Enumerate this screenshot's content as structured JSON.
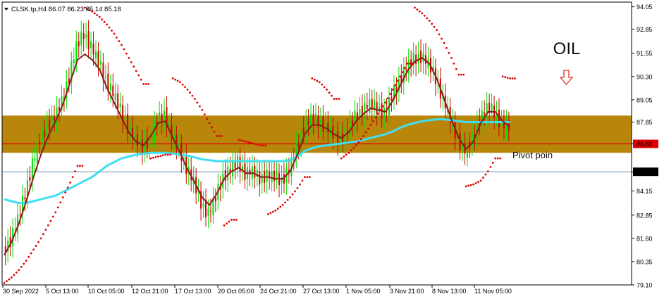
{
  "header": {
    "dropdown_icon": "triangle-down-icon",
    "symbol_info": "CLSK.tp,H4  86.07 86.23 85.14 85.18"
  },
  "annotations": {
    "instrument_label": "OIL",
    "arrow_icon": "hollow-down-arrow-icon",
    "pivot_label": "Pivot poin"
  },
  "colors": {
    "zone": "#b8860b",
    "pivot_line": "#e00000",
    "bull_candle": "#00e000",
    "bear_candle": "#d00000",
    "sar_dots": "#e00000",
    "fast_ma": "#8b1a1a",
    "slow_ma": "#40e0f0",
    "current_price_line": "#5a7ea8",
    "arrow": "#e03020"
  },
  "chart_data": {
    "type": "candlestick",
    "symbol": "CLSK.tp",
    "timeframe": "H4",
    "ohlc_last": {
      "open": 86.07,
      "high": 86.23,
      "low": 85.14,
      "close": 85.18
    },
    "ylim": [
      79.1,
      94.3
    ],
    "y_ticks": [
      "94.05",
      "92.85",
      "91.55",
      "90.30",
      "89.05",
      "87.85",
      "86.68",
      "85.18",
      "84.15",
      "82.85",
      "81.60",
      "80.35",
      "79.10"
    ],
    "x_ticks": [
      "30 Sep 2022",
      "5 Oct 13:00",
      "10 Oct 05:00",
      "12 Oct 21:00",
      "17 Oct 13:00",
      "20 Oct 05:00",
      "24 Oct 21:00",
      "27 Oct 13:00",
      "1 Nov 05:00",
      "3 Nov 21:00",
      "8 Nov 13:00",
      "11 Nov 05:00"
    ],
    "resistance_zone": {
      "low": 86.2,
      "high": 88.2
    },
    "pivot_level": 86.68,
    "current_price": 85.18,
    "close_path": [
      80.9,
      81.5,
      82.6,
      84.0,
      85.6,
      86.9,
      87.6,
      88.1,
      88.9,
      90.3,
      91.9,
      92.6,
      91.9,
      91.1,
      90.1,
      89.4,
      88.5,
      87.6,
      86.9,
      86.5,
      86.9,
      87.9,
      88.3,
      87.1,
      86.4,
      85.4,
      84.6,
      83.5,
      82.9,
      83.8,
      84.9,
      85.3,
      85.7,
      85.1,
      85.2,
      84.8,
      85.0,
      84.9,
      84.7,
      85.3,
      86.4,
      87.6,
      88.0,
      87.9,
      87.6,
      87.2,
      86.9,
      87.4,
      88.1,
      88.5,
      88.8,
      88.6,
      88.3,
      89.2,
      90.0,
      90.8,
      91.2,
      91.4,
      91.0,
      90.2,
      89.1,
      88.0,
      86.9,
      86.3,
      86.9,
      88.0,
      88.6,
      88.4,
      87.7,
      87.6
    ],
    "fast_ma": [
      80.7,
      81.4,
      82.4,
      83.6,
      84.9,
      86.1,
      87.1,
      87.9,
      88.8,
      90.0,
      91.2,
      91.5,
      91.2,
      90.7,
      89.7,
      88.9,
      88.1,
      87.3,
      86.8,
      86.6,
      87.1,
      87.8,
      87.9,
      87.0,
      86.2,
      85.3,
      84.6,
      83.8,
      83.4,
      84.0,
      84.8,
      85.2,
      85.4,
      85.1,
      85.1,
      84.9,
      84.9,
      84.8,
      84.8,
      85.2,
      86.1,
      87.2,
      87.7,
      87.7,
      87.5,
      87.2,
      87.0,
      87.3,
      87.9,
      88.3,
      88.6,
      88.5,
      88.4,
      89.0,
      89.8,
      90.6,
      91.1,
      91.3,
      91.0,
      90.2,
      89.1,
      88.0,
      87.0,
      86.4,
      86.8,
      87.8,
      88.4,
      88.4,
      87.9,
      87.6
    ],
    "slow_ma": [
      83.7,
      83.6,
      83.5,
      83.5,
      83.6,
      83.7,
      83.8,
      83.9,
      84.1,
      84.3,
      84.5,
      84.7,
      84.9,
      85.2,
      85.5,
      85.7,
      85.9,
      86.0,
      86.1,
      86.15,
      86.2,
      86.2,
      86.2,
      86.15,
      86.1,
      86.05,
      85.95,
      85.85,
      85.8,
      85.75,
      85.75,
      85.75,
      85.75,
      85.75,
      85.75,
      85.75,
      85.75,
      85.75,
      85.75,
      85.8,
      86.0,
      86.3,
      86.45,
      86.55,
      86.6,
      86.65,
      86.7,
      86.75,
      86.8,
      86.9,
      87.0,
      87.1,
      87.2,
      87.35,
      87.55,
      87.7,
      87.8,
      87.9,
      87.95,
      88.0,
      88.0,
      87.95,
      87.9,
      87.85,
      87.85,
      87.85,
      87.85,
      87.85,
      87.85,
      87.85
    ],
    "sar": [
      [
        0,
        79.2
      ],
      [
        1,
        79.5
      ],
      [
        2,
        79.9
      ],
      [
        3,
        80.4
      ],
      [
        4,
        81.0
      ],
      [
        5,
        81.6
      ],
      [
        6,
        82.3
      ],
      [
        7,
        83.0
      ],
      [
        8,
        83.8
      ],
      [
        9,
        84.6
      ],
      [
        10,
        85.5
      ],
      [
        11,
        94.0
      ],
      [
        12,
        93.8
      ],
      [
        13,
        93.5
      ],
      [
        14,
        93.1
      ],
      [
        15,
        92.6
      ],
      [
        16,
        92.0
      ],
      [
        17,
        91.3
      ],
      [
        18,
        90.6
      ],
      [
        19,
        89.9
      ],
      [
        20,
        85.9
      ],
      [
        21,
        86.0
      ],
      [
        22,
        86.1
      ],
      [
        23,
        90.2
      ],
      [
        24,
        90.0
      ],
      [
        25,
        89.6
      ],
      [
        26,
        89.1
      ],
      [
        27,
        88.5
      ],
      [
        28,
        87.8
      ],
      [
        29,
        87.1
      ],
      [
        30,
        82.3
      ],
      [
        31,
        82.6
      ],
      [
        32,
        86.9
      ],
      [
        33,
        86.8
      ],
      [
        34,
        86.7
      ],
      [
        35,
        86.6
      ],
      [
        36,
        82.9
      ],
      [
        37,
        83.1
      ],
      [
        38,
        83.4
      ],
      [
        39,
        83.8
      ],
      [
        40,
        84.3
      ],
      [
        41,
        84.9
      ],
      [
        42,
        90.2
      ],
      [
        43,
        90.0
      ],
      [
        44,
        89.6
      ],
      [
        45,
        89.1
      ],
      [
        46,
        85.9
      ],
      [
        47,
        86.2
      ],
      [
        48,
        86.6
      ],
      [
        49,
        87.1
      ],
      [
        50,
        87.7
      ],
      [
        51,
        88.3
      ],
      [
        52,
        88.9
      ],
      [
        53,
        89.6
      ],
      [
        54,
        90.3
      ],
      [
        55,
        91.0
      ],
      [
        56,
        94.0
      ],
      [
        57,
        93.7
      ],
      [
        58,
        93.3
      ],
      [
        59,
        92.8
      ],
      [
        60,
        92.1
      ],
      [
        61,
        91.3
      ],
      [
        62,
        90.4
      ],
      [
        63,
        84.4
      ],
      [
        64,
        84.5
      ],
      [
        65,
        84.7
      ],
      [
        66,
        85.2
      ],
      [
        67,
        85.9
      ],
      [
        68,
        90.3
      ],
      [
        69,
        90.2
      ]
    ]
  }
}
